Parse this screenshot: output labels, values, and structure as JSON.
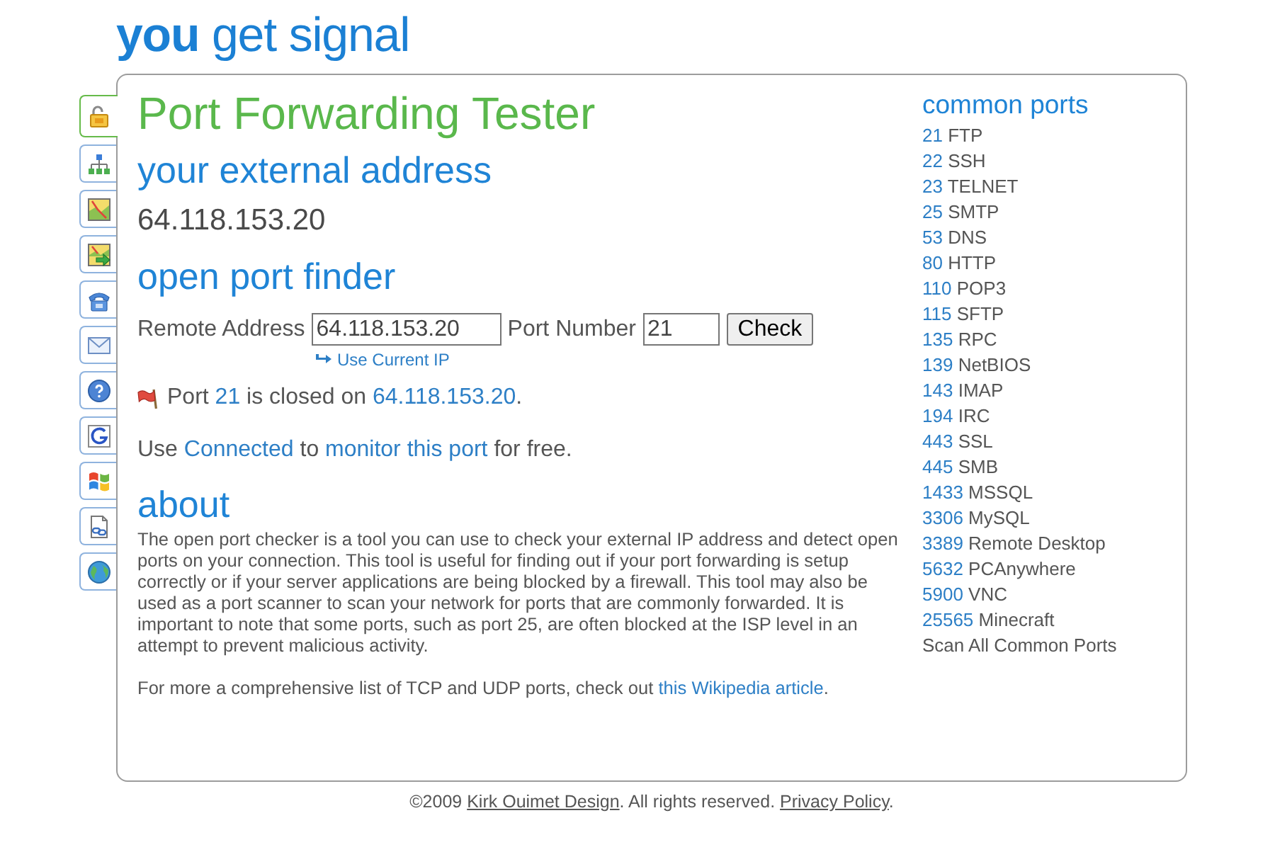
{
  "logo": "**you** get signal",
  "side_tabs": [
    {
      "selected": true
    },
    {
      "selected": false
    },
    {
      "selected": false
    },
    {
      "selected": false
    },
    {
      "selected": false
    },
    {
      "selected": false
    },
    {
      "selected": false
    },
    {
      "selected": false
    },
    {
      "selected": false
    },
    {
      "selected": false
    },
    {
      "selected": false
    }
  ],
  "title": "Port Forwarding Tester",
  "external_address": {
    "heading": "your external address",
    "value": "64.118.153.20"
  },
  "port_finder": {
    "heading": "open port finder",
    "fields": [
      {
        "label": "Remote Address",
        "value": "64.118.153.20"
      },
      {
        "label": "Port Number",
        "value": "21"
      }
    ],
    "button": "Check",
    "current_ip_link": "Use Current IP",
    "result": [
      {
        "text": "Port ",
        "kind": "text"
      },
      {
        "text": "21",
        "kind": "link"
      },
      {
        "text": " is closed on ",
        "kind": "text"
      },
      {
        "text": "64.118.153.20",
        "kind": "link"
      },
      {
        "text": ".",
        "kind": "text"
      }
    ]
  },
  "connected_promo": [
    {
      "text": "Use ",
      "kind": "text"
    },
    {
      "text": "Connected",
      "kind": "link"
    },
    {
      "text": " to ",
      "kind": "text"
    },
    {
      "text": "monitor this port",
      "kind": "link"
    },
    {
      "text": " for free.",
      "kind": "text"
    }
  ],
  "about": {
    "heading": "about",
    "paragraphs": [
      [
        {
          "text": "The open port checker is a tool you can use to check your external IP address and detect open ports on your connection. This tool is useful for finding out if your port forwarding is setup correctly or if your server applications are being blocked by a firewall. This tool may also be used as a port scanner to scan your network for ports that are commonly forwarded. It is important to note that some ports, such as port 25, are often blocked at the ISP level in an attempt to prevent malicious activity.",
          "kind": "text"
        }
      ],
      [
        {
          "text": "For more a comprehensive list of TCP and UDP ports, check out ",
          "kind": "text"
        },
        {
          "text": "this Wikipedia article",
          "kind": "link"
        },
        {
          "text": ".",
          "kind": "text"
        }
      ]
    ]
  },
  "common_ports": {
    "heading": "common ports",
    "ports": [
      {
        "number": "21",
        "name": "FTP"
      },
      {
        "number": "22",
        "name": "SSH"
      },
      {
        "number": "23",
        "name": "TELNET"
      },
      {
        "number": "25",
        "name": "SMTP"
      },
      {
        "number": "53",
        "name": "DNS"
      },
      {
        "number": "80",
        "name": "HTTP"
      },
      {
        "number": "110",
        "name": "POP3"
      },
      {
        "number": "115",
        "name": "SFTP"
      },
      {
        "number": "135",
        "name": "RPC"
      },
      {
        "number": "139",
        "name": "NetBIOS"
      },
      {
        "number": "143",
        "name": "IMAP"
      },
      {
        "number": "194",
        "name": "IRC"
      },
      {
        "number": "443",
        "name": "SSL"
      },
      {
        "number": "445",
        "name": "SMB"
      },
      {
        "number": "1433",
        "name": "MSSQL"
      },
      {
        "number": "3306",
        "name": "MySQL"
      },
      {
        "number": "3389",
        "name": "Remote Desktop"
      },
      {
        "number": "5632",
        "name": "PCAnywhere"
      },
      {
        "number": "5900",
        "name": "VNC"
      },
      {
        "number": "25565",
        "name": "Minecraft"
      }
    ],
    "scan_all": "Scan All Common Ports"
  },
  "footer": [
    {
      "text": "©2009 ",
      "kind": "text"
    },
    {
      "text": "Kirk Ouimet Design",
      "kind": "link"
    },
    {
      "text": ". All rights reserved. ",
      "kind": "text"
    },
    {
      "text": "Privacy Policy",
      "kind": "link"
    },
    {
      "text": ".",
      "kind": "text"
    }
  ]
}
